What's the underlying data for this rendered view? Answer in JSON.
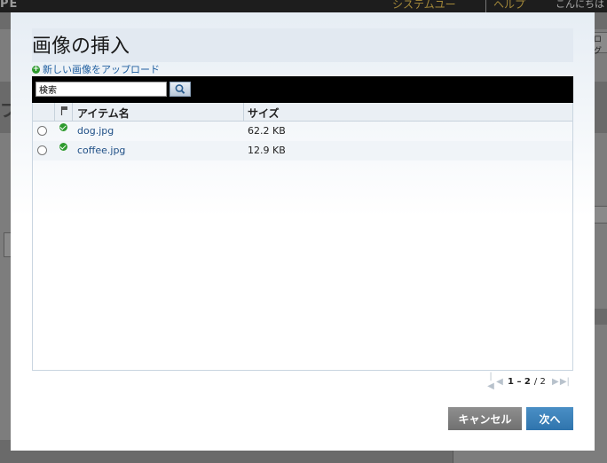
{
  "background": {
    "brand_partial": "PE",
    "nav_item_1": "システムユー",
    "nav_item_2": "ヘルプ",
    "greeting": "こんにちは",
    "side_glyph": "ブ",
    "right_tab": "ログ"
  },
  "dialog": {
    "title": "画像の挿入",
    "upload_link": "新しい画像をアップロード",
    "search": {
      "value": "検索"
    },
    "table": {
      "headers": {
        "name": "アイテム名",
        "size": "サイズ"
      },
      "rows": [
        {
          "name": "dog.jpg",
          "size": "62.2 KB"
        },
        {
          "name": "coffee.jpg",
          "size": "12.9 KB"
        }
      ]
    },
    "pager": {
      "range": "1 – 2",
      "total": "/ 2"
    },
    "buttons": {
      "cancel": "キャンセル",
      "next": "次へ"
    }
  },
  "colors": {
    "accent": "#2f74ad",
    "link": "#1f4f86",
    "status_ok": "#2e9a2e"
  }
}
